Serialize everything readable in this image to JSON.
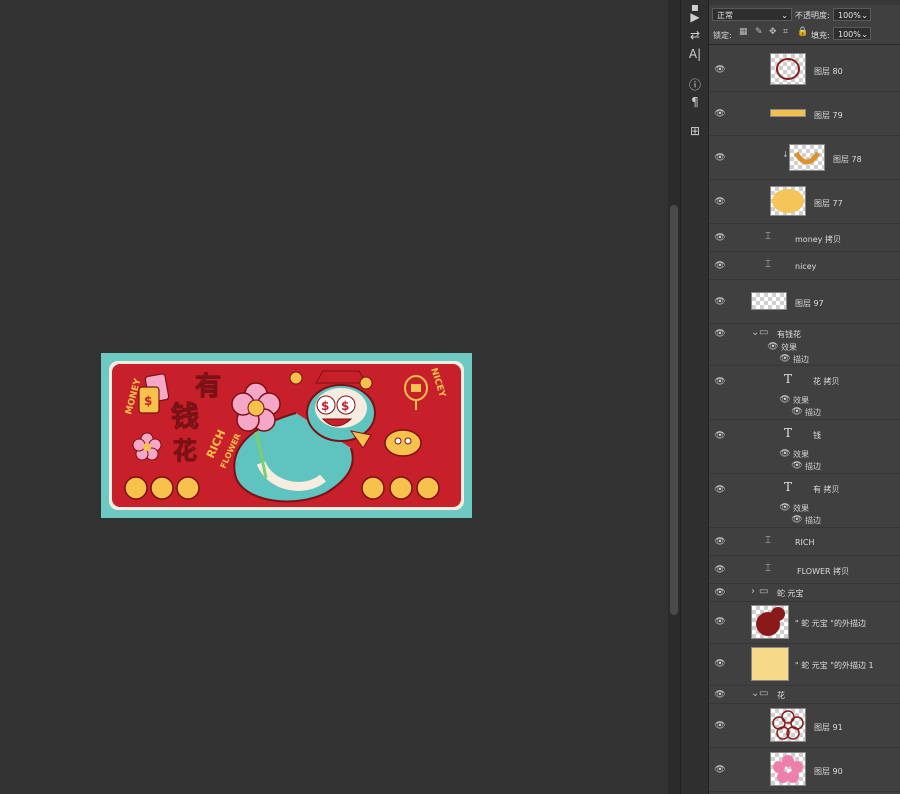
{
  "toolbar_top": {
    "blend_mode": "正常",
    "opacity_label": "不透明度:",
    "opacity_value": "100%",
    "lock_label": "锁定:",
    "fill_label": "填充:",
    "fill_value": "100%"
  },
  "artwork": {
    "text_money": "MONEY",
    "text_nicey": "NICEY",
    "text_rich": "RICH",
    "text_flower": "FLOWER",
    "chars": [
      "有",
      "钱",
      "花"
    ],
    "eye_symbol": "$",
    "colors": {
      "bg_teal": "#6dc9c2",
      "bg_red": "#c8202a",
      "gold": "#f6c24b",
      "pink": "#f5a7c8"
    }
  },
  "layers": [
    {
      "name": "图层 80",
      "type": "pixel"
    },
    {
      "name": "图层 79",
      "type": "pixel"
    },
    {
      "name": "图层 78",
      "type": "pixel-clipped"
    },
    {
      "name": "图层 77",
      "type": "pixel"
    },
    {
      "name": "money 拷贝",
      "type": "smart"
    },
    {
      "name": "nicey",
      "type": "smart"
    },
    {
      "name": "图层 97",
      "type": "pixel"
    },
    {
      "name": "有钱花",
      "type": "group",
      "effects_label": "效果",
      "stroke_label": "描边"
    },
    {
      "name": "花 拷贝",
      "type": "text",
      "effects_label": "效果",
      "stroke_label": "描边"
    },
    {
      "name": "钱",
      "type": "text",
      "effects_label": "效果",
      "stroke_label": "描边"
    },
    {
      "name": "有 拷贝",
      "type": "text",
      "effects_label": "效果",
      "stroke_label": "描边"
    },
    {
      "name": "RICH",
      "type": "smart"
    },
    {
      "name": "FLOWER 拷贝",
      "type": "smart"
    },
    {
      "name": "蛇 元宝",
      "type": "group"
    },
    {
      "name": "\" 蛇 元宝 \"的外描边",
      "type": "pixel"
    },
    {
      "name": "\" 蛇 元宝 \"的外描边 1",
      "type": "pixel"
    },
    {
      "name": "花",
      "type": "group"
    },
    {
      "name": "图层 91",
      "type": "pixel"
    },
    {
      "name": "图层 90",
      "type": "pixel"
    }
  ],
  "icons": {
    "visibility": "eye-icon",
    "text_layer": "T",
    "smart_object": "smart-object-icon",
    "folder": "folder-icon"
  }
}
